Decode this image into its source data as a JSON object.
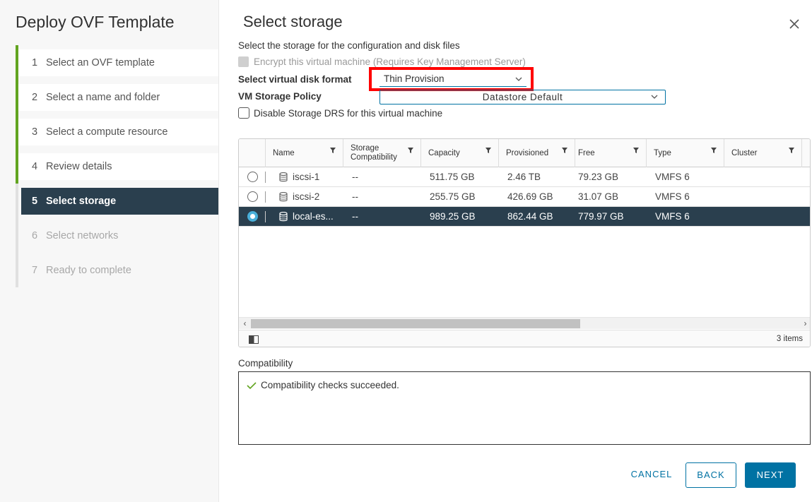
{
  "wizard": {
    "title": "Deploy OVF Template",
    "steps": [
      {
        "num": "1",
        "label": "Select an OVF template",
        "state": "done"
      },
      {
        "num": "2",
        "label": "Select a name and folder",
        "state": "done"
      },
      {
        "num": "3",
        "label": "Select a compute resource",
        "state": "done"
      },
      {
        "num": "4",
        "label": "Review details",
        "state": "done"
      },
      {
        "num": "5",
        "label": "Select storage",
        "state": "active"
      },
      {
        "num": "6",
        "label": "Select networks",
        "state": "future"
      },
      {
        "num": "7",
        "label": "Ready to complete",
        "state": "future"
      }
    ]
  },
  "page": {
    "title": "Select storage",
    "subtitle": "Select the storage for the configuration and disk files",
    "encrypt_label": "Encrypt this virtual machine (Requires Key Management Server)",
    "disk_format_label": "Select virtual disk format",
    "disk_format_value": "Thin Provision",
    "storage_policy_label": "VM Storage Policy",
    "storage_policy_value": "Datastore Default",
    "disable_drs_label": "Disable Storage DRS for this virtual machine"
  },
  "grid": {
    "columns": [
      "Name",
      "Storage Compatibility",
      "Capacity",
      "Provisioned",
      "Free",
      "Type",
      "Cluster"
    ],
    "rows": [
      {
        "name": "iscsi-1",
        "compat": "--",
        "capacity": "511.75 GB",
        "provisioned": "2.46 TB",
        "free": "79.23 GB",
        "type": "VMFS 6",
        "cluster": "",
        "selected": false
      },
      {
        "name": "iscsi-2",
        "compat": "--",
        "capacity": "255.75 GB",
        "provisioned": "426.69 GB",
        "free": "31.07 GB",
        "type": "VMFS 6",
        "cluster": "",
        "selected": false
      },
      {
        "name": "local-es...",
        "compat": "--",
        "capacity": "989.25 GB",
        "provisioned": "862.44 GB",
        "free": "779.97 GB",
        "type": "VMFS 6",
        "cluster": "",
        "selected": true
      }
    ],
    "item_count": "3 items"
  },
  "compatibility": {
    "label": "Compatibility",
    "message": "Compatibility checks succeeded."
  },
  "buttons": {
    "cancel": "CANCEL",
    "back": "BACK",
    "next": "NEXT"
  },
  "colors": {
    "accent": "#0072a3",
    "nav_active": "#2a3f4e",
    "step_done": "#62a420",
    "highlight": "#ff0000"
  },
  "icons": {
    "close": "close-icon",
    "filter": "filter-icon",
    "datastore": "datastore-icon",
    "chevron": "chevron-down-icon",
    "check": "check-icon",
    "columns": "column-toggle-icon"
  }
}
